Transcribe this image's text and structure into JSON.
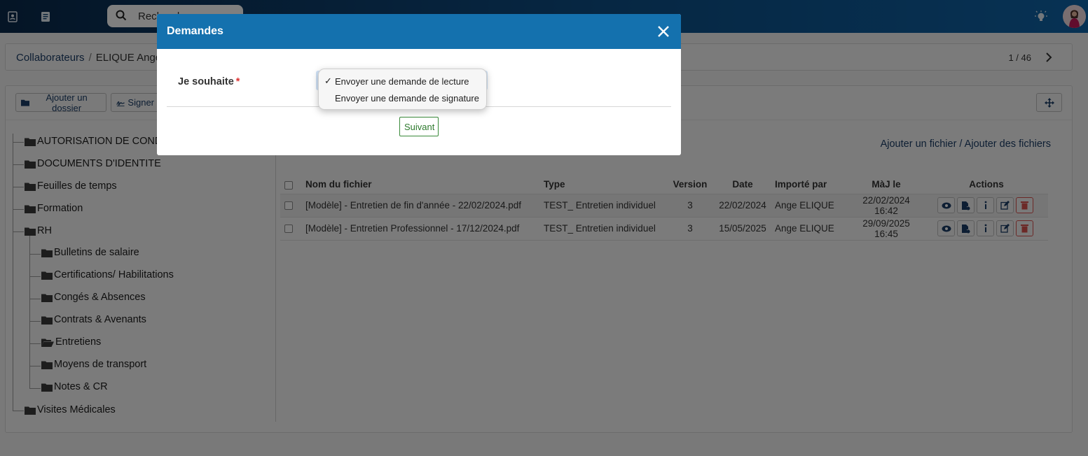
{
  "topbar": {
    "search_value": "Rechercher",
    "icons": [
      "contacts-icon",
      "document-icon",
      "search-icon",
      "lightbulb-icon"
    ]
  },
  "breadcrumb": {
    "items": [
      "Collaborateurs",
      "ELIQUE Ange"
    ],
    "pager": "1 / 46"
  },
  "toolbar": {
    "add_folder_label": "Ajouter un dossier",
    "sign_label": "Signer"
  },
  "tree": {
    "folders": [
      {
        "label": "AUTORISATION DE CONDUITE",
        "level": 0
      },
      {
        "label": "DOCUMENTS D'IDENTITE",
        "level": 0
      },
      {
        "label": "Feuilles de temps",
        "level": 0
      },
      {
        "label": "Formation",
        "level": 0
      },
      {
        "label": "RH",
        "level": 0
      },
      {
        "label": "Bulletins de salaire",
        "level": 1
      },
      {
        "label": "Certifications/ Habilitations",
        "level": 1
      },
      {
        "label": "Congés & Absences",
        "level": 1
      },
      {
        "label": "Contrats & Avenants",
        "level": 1
      },
      {
        "label": "Entretiens",
        "level": 1,
        "open": true
      },
      {
        "label": "Moyens de transport",
        "level": 1
      },
      {
        "label": "Notes & CR",
        "level": 1
      },
      {
        "label": "Visites Médicales",
        "level": 0
      }
    ]
  },
  "files": {
    "add_link": "Ajouter un fichier / Ajouter des fichiers",
    "headers": {
      "name": "Nom du fichier",
      "type": "Type",
      "version": "Version",
      "date": "Date",
      "imported_by": "Importé par",
      "updated": "MàJ le",
      "actions": "Actions"
    },
    "rows": [
      {
        "name": "[Modèle] - Entretien de fin d'année - 22/02/2024.pdf",
        "type": "TEST_ Entretien individuel",
        "version": "3",
        "date": "22/02/2024",
        "imported_by": "Ange ELIQUE",
        "updated": "22/02/2024 16:42"
      },
      {
        "name": "[Modèle] - Entretien Professionnel - 17/12/2024.pdf",
        "type": "TEST_ Entretien individuel",
        "version": "3",
        "date": "15/05/2025",
        "imported_by": "Ange ELIQUE",
        "updated": "29/09/2025 16:45"
      }
    ]
  },
  "modal": {
    "title": "Demandes",
    "field_label": "Je souhaite",
    "required_mark": "*",
    "options": [
      "Envoyer une demande de lecture",
      "Envoyer une demande de signature"
    ],
    "selected_index": 0,
    "check_mark": "✓",
    "next_label": "Suivant"
  },
  "colors": {
    "modal_header": "#1471ae",
    "link": "#1b3d66",
    "delete": "#d9534f",
    "next_button": "#2d7a2d"
  }
}
